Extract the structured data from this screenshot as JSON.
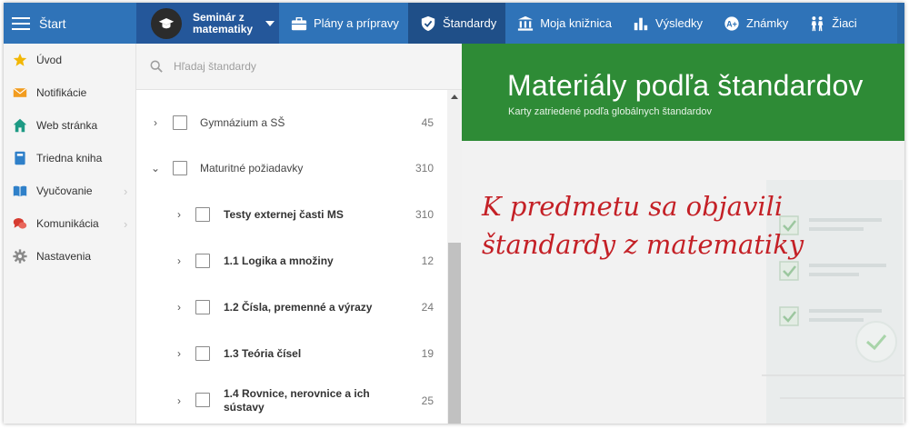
{
  "topbar": {
    "start_label": "Štart",
    "subject_label": "Seminár z matematiky",
    "nav": [
      {
        "label": "Plány a prípravy",
        "icon": "briefcase-icon",
        "active": false
      },
      {
        "label": "Štandardy",
        "icon": "shield-icon",
        "active": true
      },
      {
        "label": "Moja knižnica",
        "icon": "library-icon",
        "active": false
      },
      {
        "label": "Výsledky",
        "icon": "bar-chart-icon",
        "active": false
      },
      {
        "label": "Známky",
        "icon": "grades-icon",
        "active": false
      },
      {
        "label": "Žiaci",
        "icon": "students-icon",
        "active": false
      }
    ]
  },
  "sidebar": {
    "items": [
      {
        "label": "Úvod",
        "icon": "star-icon",
        "color": "#f2b705",
        "has_arrow": false
      },
      {
        "label": "Notifikácie",
        "icon": "envelope-icon",
        "color": "#f29c1f",
        "has_arrow": false
      },
      {
        "label": "Web stránka",
        "icon": "home-icon",
        "color": "#1e9a84",
        "has_arrow": false
      },
      {
        "label": "Triedna kniha",
        "icon": "book-icon",
        "color": "#2f80c9",
        "has_arrow": false
      },
      {
        "label": "Vyučovanie",
        "icon": "open-book-icon",
        "color": "#2f80c9",
        "has_arrow": true
      },
      {
        "label": "Komunikácia",
        "icon": "chat-icon",
        "color": "#d63b30",
        "has_arrow": true
      },
      {
        "label": "Nastavenia",
        "icon": "gear-icon",
        "color": "#8a8a8a",
        "has_arrow": false
      }
    ]
  },
  "search": {
    "placeholder": "Hľadaj štandardy"
  },
  "tree": {
    "rows": [
      {
        "label": "Gymnázium a SŠ",
        "count": "45",
        "level": 0,
        "expanded": false,
        "bold": false
      },
      {
        "label": "Maturitné požiadavky",
        "count": "310",
        "level": 0,
        "expanded": true,
        "bold": false
      },
      {
        "label": "Testy externej časti MS",
        "count": "310",
        "level": 1,
        "expanded": false,
        "bold": true
      },
      {
        "label": "1.1 Logika a množiny",
        "count": "12",
        "level": 1,
        "expanded": false,
        "bold": true
      },
      {
        "label": "1.2 Čísla, premenné a výrazy",
        "count": "24",
        "level": 1,
        "expanded": false,
        "bold": true
      },
      {
        "label": "1.3 Teória čísel",
        "count": "19",
        "level": 1,
        "expanded": false,
        "bold": true
      },
      {
        "label": "1.4 Rovnice, nerovnice a ich sústavy",
        "count": "25",
        "level": 1,
        "expanded": false,
        "bold": true
      }
    ]
  },
  "content": {
    "title": "Materiály podľa štandardov",
    "subtitle": "Karty zatriedené podľa globálnych štandardov",
    "annotation_line1": "K predmetu sa objavili",
    "annotation_line2": "štandardy z matematiky",
    "annotation_color": "#c42026",
    "banner_color": "#2e8b36"
  },
  "colors": {
    "topbar": "#2f73b8",
    "topbar_active": "#1f4f88",
    "subject_bg": "#24579a"
  }
}
